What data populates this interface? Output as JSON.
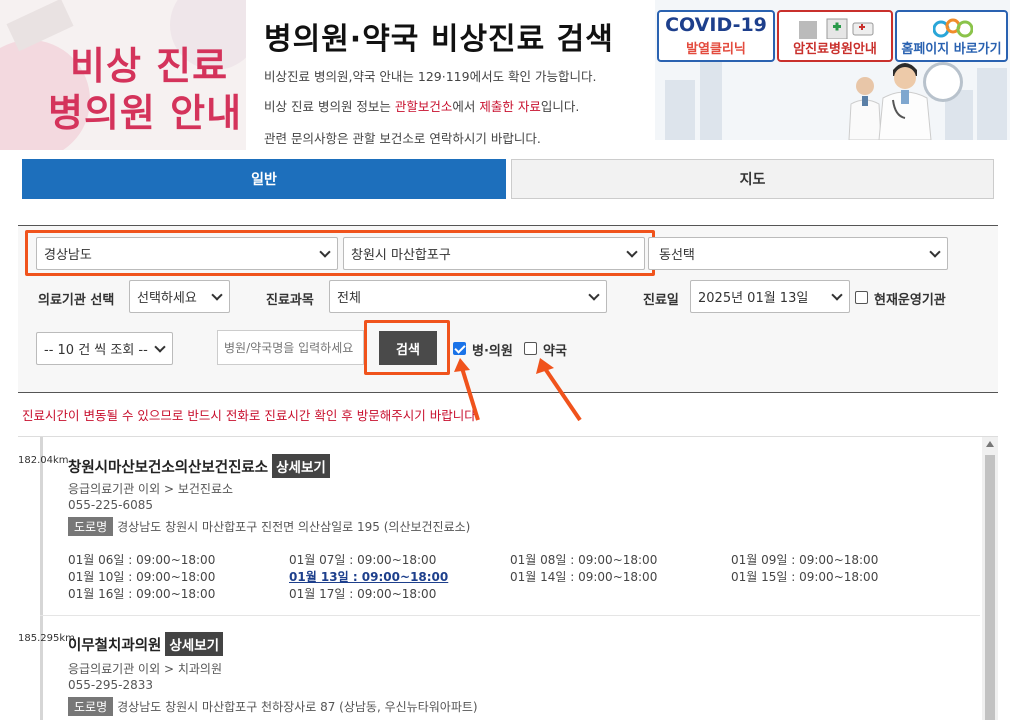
{
  "header": {
    "logo_line1": "비상 진료",
    "logo_line2": "병의원 안내",
    "title": "병의원·약국 비상진료 검색",
    "info1": "비상진료 병의원,약국 안내는 129·119에서도 확인 가능합니다.",
    "info2_pre": "비상 진료 병의원 정보는 ",
    "info2_red1": "관할보건소",
    "info2_mid": "에서 ",
    "info2_red2": "제출한 자료",
    "info2_post": "입니다.",
    "info3": "관련 문의사항은 관할 보건소로 연락하시기 바랍니다.",
    "banner_covid_title": "COVID-19",
    "banner_covid_sub": "발열클리닉",
    "banner_cancer": "암진료병원안내",
    "banner_home": "홈페이지 바로가기"
  },
  "tabs": {
    "general": "일반",
    "map": "지도"
  },
  "filter": {
    "province": "경상남도",
    "city": "창원시 마산합포구",
    "dong": "동선택",
    "facility_label": "의료기관 선택",
    "facility_value": "선택하세요",
    "dept_label": "진료과목",
    "dept_value": "전체",
    "date_label": "진료일",
    "date_value": "2025년 01월 13일",
    "open_now_label": "현재운영기관",
    "page_size": "-- 10 건 씩 조회 --",
    "search_placeholder": "병원/약국명을 입력하세요",
    "search_button": "검색",
    "hospital_label": "병·의원",
    "hospital_checked": true,
    "pharmacy_label": "약국",
    "pharmacy_checked": false
  },
  "notice": "진료시간이 변동될 수 있으므로 반드시 전화로 진료시간 확인 후 방문해주시기 바랍니다.",
  "results": [
    {
      "distance": "182.04km",
      "name": "창원시마산보건소의산보건진료소",
      "detail_label": "상세보기",
      "type": "응급의료기관 이외 > 보건진료소",
      "phone": "055-225-6085",
      "road_tag": "도로명",
      "address": "경상남도 창원시 마산합포구 진전면 의산삼일로 195 (의산보건진료소)",
      "hours": [
        "01월 06일 : 09:00~18:00",
        "01월 07일 : 09:00~18:00",
        "01월 08일 : 09:00~18:00",
        "01월 09일 : 09:00~18:00",
        "01월 10일 : 09:00~18:00",
        "01월 13일 : 09:00~18:00",
        "01월 14일 : 09:00~18:00",
        "01월 15일 : 09:00~18:00",
        "01월 16일 : 09:00~18:00",
        "01월 17일 : 09:00~18:00"
      ]
    },
    {
      "distance": "185.295km",
      "name": "이무철치과의원",
      "detail_label": "상세보기",
      "type": "응급의료기관 이외 > 치과의원",
      "phone": "055-295-2833",
      "road_tag": "도로명",
      "address": "경상남도 창원시 마산합포구 천하장사로 87 (상남동, 우신뉴타워아파트)"
    }
  ]
}
